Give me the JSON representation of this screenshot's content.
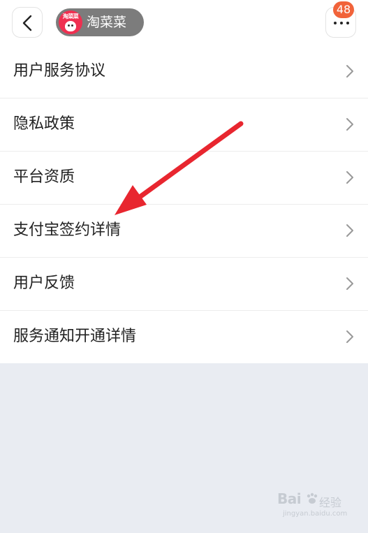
{
  "header": {
    "back_icon": "chevron-left-icon",
    "mini_app": {
      "logo_text": "淘菜菜",
      "name": "淘菜菜"
    },
    "more_icon": "more-dots-icon",
    "notification_count": "48"
  },
  "menu": {
    "items": [
      {
        "label": "用户服务协议"
      },
      {
        "label": "隐私政策"
      },
      {
        "label": "平台资质"
      },
      {
        "label": "支付宝签约详情"
      },
      {
        "label": "用户反馈"
      },
      {
        "label": "服务通知开通详情"
      }
    ],
    "chevron_icon": "chevron-right-icon"
  },
  "annotation": {
    "icon": "red-arrow-annotation",
    "color": "#e8262f"
  },
  "watermark": {
    "brand": "Bai",
    "brand_suffix": "经验",
    "url": "jingyan.baidu.com"
  },
  "colors": {
    "page_bg": "#e9ecf2",
    "badge": "#f1633a",
    "pill": "#7c7c7c",
    "logo": "#ef2f50"
  }
}
